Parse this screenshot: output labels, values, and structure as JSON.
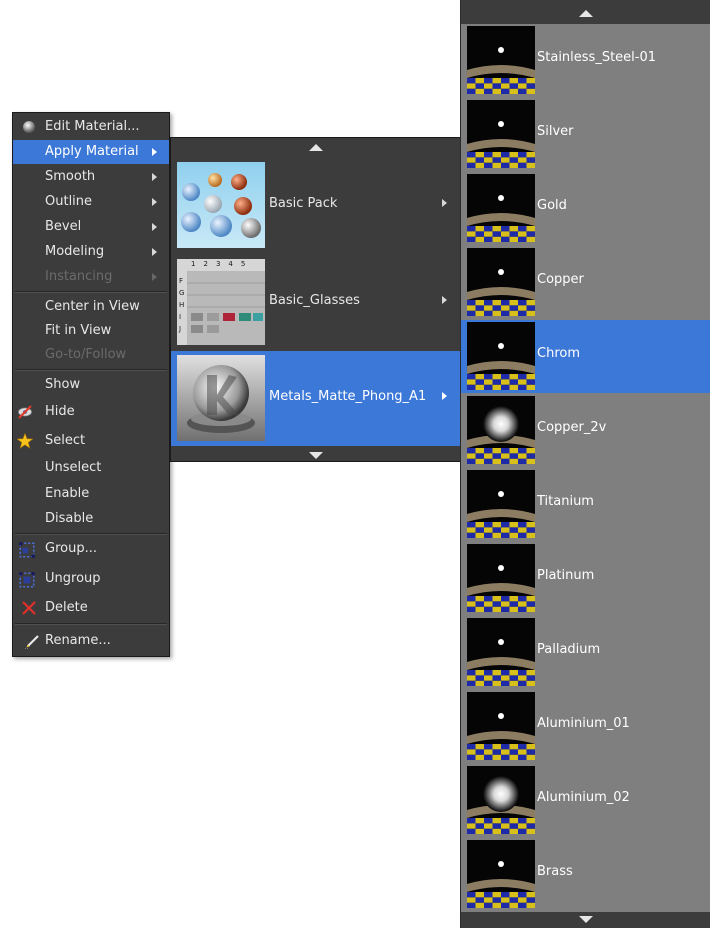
{
  "context_menu": {
    "items": [
      {
        "label": "Edit Material...",
        "state": "normal",
        "submenu": false,
        "icon": "material-sphere-icon"
      },
      {
        "label": "Apply Material",
        "state": "active",
        "submenu": true,
        "icon": ""
      },
      {
        "label": "Smooth",
        "state": "normal",
        "submenu": true,
        "icon": ""
      },
      {
        "label": "Outline",
        "state": "normal",
        "submenu": true,
        "icon": ""
      },
      {
        "label": "Bevel",
        "state": "normal",
        "submenu": true,
        "icon": ""
      },
      {
        "label": "Modeling",
        "state": "normal",
        "submenu": true,
        "icon": ""
      },
      {
        "label": "Instancing",
        "state": "disabled",
        "submenu": true,
        "icon": ""
      },
      {
        "label": "Center in View",
        "state": "normal",
        "submenu": false,
        "icon": ""
      },
      {
        "label": "Fit in View",
        "state": "normal",
        "submenu": false,
        "icon": ""
      },
      {
        "label": "Go-to/Follow",
        "state": "disabled",
        "submenu": false,
        "icon": ""
      },
      {
        "label": "Show",
        "state": "normal",
        "submenu": false,
        "icon": ""
      },
      {
        "label": "Hide",
        "state": "normal",
        "submenu": false,
        "icon": "hide-eye-icon"
      },
      {
        "label": "Select",
        "state": "normal",
        "submenu": false,
        "icon": "select-star-icon"
      },
      {
        "label": "Unselect",
        "state": "normal",
        "submenu": false,
        "icon": ""
      },
      {
        "label": "Enable",
        "state": "normal",
        "submenu": false,
        "icon": ""
      },
      {
        "label": "Disable",
        "state": "normal",
        "submenu": false,
        "icon": ""
      },
      {
        "label": "Group...",
        "state": "normal",
        "submenu": false,
        "icon": "group-icon"
      },
      {
        "label": "Ungroup",
        "state": "normal",
        "submenu": false,
        "icon": "ungroup-icon"
      },
      {
        "label": "Delete",
        "state": "normal",
        "submenu": false,
        "icon": "delete-x-icon"
      },
      {
        "label": "Rename...",
        "state": "normal",
        "submenu": false,
        "icon": "rename-pencil-icon"
      }
    ]
  },
  "pack_menu": {
    "packs": [
      {
        "label": "Basic Pack",
        "active": false
      },
      {
        "label": "Basic_Glasses",
        "active": false
      },
      {
        "label": "Metals_Matte_Phong_A1",
        "active": true
      }
    ],
    "glasses_grid_columns": [
      "1",
      "2",
      "3",
      "4",
      "5"
    ],
    "glasses_grid_rows": [
      "F",
      "G",
      "H",
      "I",
      "J"
    ]
  },
  "materials_menu": {
    "items": [
      {
        "label": "Stainless_Steel-01",
        "active": false
      },
      {
        "label": "Silver",
        "active": false
      },
      {
        "label": "Gold",
        "active": false
      },
      {
        "label": "Copper",
        "active": false
      },
      {
        "label": "Chrom",
        "active": true
      },
      {
        "label": "Copper_2v",
        "active": false
      },
      {
        "label": "Titanium",
        "active": false
      },
      {
        "label": "Platinum",
        "active": false
      },
      {
        "label": "Palladium",
        "active": false
      },
      {
        "label": "Aluminium_01",
        "active": false
      },
      {
        "label": "Aluminium_02",
        "active": false
      },
      {
        "label": "Brass",
        "active": false
      }
    ]
  },
  "colors": {
    "menu_bg": "#3c3c3c",
    "highlight": "#3c78d8",
    "materials_bg": "#7f7f7f",
    "disabled_text": "#6b6b6b"
  }
}
